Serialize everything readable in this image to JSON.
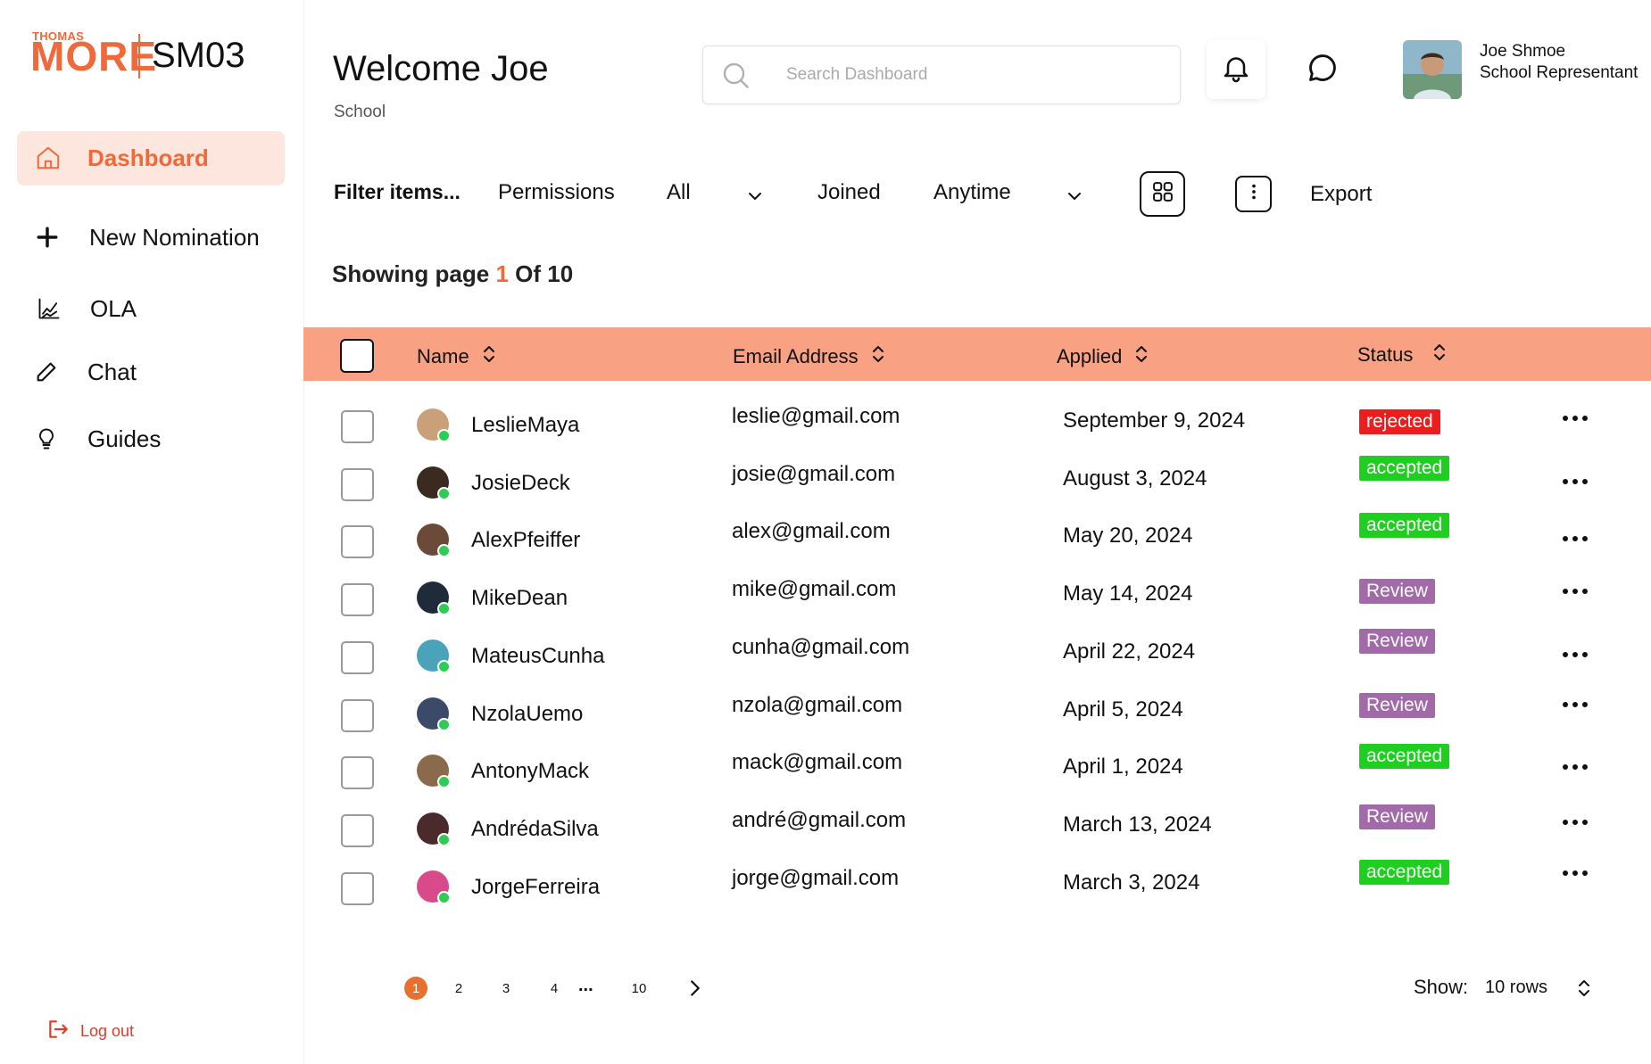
{
  "brand": {
    "top": "THOMAS",
    "main": "MORE",
    "code": "SM03",
    "color": "#ef6a3a"
  },
  "sidebar": {
    "items": [
      {
        "label": "Dashboard",
        "icon": "home-icon",
        "active": true
      },
      {
        "label": "New Nomination",
        "icon": "plus-icon"
      },
      {
        "label": "OLA",
        "icon": "chart-icon"
      },
      {
        "label": "Chat",
        "icon": "pencil-icon"
      },
      {
        "label": "Guides",
        "icon": "lightbulb-icon"
      }
    ],
    "logout": "Log out"
  },
  "header": {
    "title": "Welcome Joe",
    "subtitle": "School",
    "search_placeholder": "Search Dashboard",
    "user": {
      "name": "Joe Shmoe",
      "role": "School Representant"
    }
  },
  "filters": {
    "label": "Filter items...",
    "permissions": "Permissions",
    "all": "All",
    "joined": "Joined",
    "anytime": "Anytime",
    "export": "Export"
  },
  "paging_info": {
    "prefix": "Showing page",
    "current": "1",
    "suffix": "Of 10"
  },
  "table": {
    "header_color": "#f9a283",
    "columns": [
      "Name",
      "Email Address",
      "Applied",
      "Status"
    ],
    "rows": [
      {
        "name": "LeslieMaya",
        "email": "leslie@gmail.com",
        "applied": "September 9, 2024",
        "status": "rejected",
        "avatar": "#c9a07a"
      },
      {
        "name": "JosieDeck",
        "email": "josie@gmail.com",
        "applied": "August 3, 2024",
        "status": "accepted",
        "avatar": "#3b2a20"
      },
      {
        "name": "AlexPfeiffer",
        "email": "alex@gmail.com",
        "applied": "May 20, 2024",
        "status": "accepted",
        "avatar": "#6b4a3a"
      },
      {
        "name": "MikeDean",
        "email": "mike@gmail.com",
        "applied": "May 14, 2024",
        "status": "Review",
        "avatar": "#1f2a3a"
      },
      {
        "name": "MateusCunha",
        "email": "cunha@gmail.com",
        "applied": "April 22, 2024",
        "status": "Review",
        "avatar": "#4aa3b8"
      },
      {
        "name": "NzolaUemo",
        "email": "nzola@gmail.com",
        "applied": "April 5, 2024",
        "status": "Review",
        "avatar": "#3c4a6a"
      },
      {
        "name": "AntonyMack",
        "email": "mack@gmail.com",
        "applied": "April 1, 2024",
        "status": "accepted",
        "avatar": "#8a6a4a"
      },
      {
        "name": "AndrédaSilva",
        "email": "andré@gmail.com",
        "applied": "March 13, 2024",
        "status": "Review",
        "avatar": "#4a2a2a"
      },
      {
        "name": "JorgeFerreira",
        "email": "jorge@gmail.com",
        "applied": "March 3, 2024",
        "status": "accepted",
        "avatar": "#d94a8a"
      }
    ],
    "status_colors": {
      "rejected": "#ee1c1c",
      "accepted": "#1fcf1f",
      "Review": "#a26aa8"
    }
  },
  "pagination": {
    "pages": [
      "1",
      "2",
      "3",
      "4"
    ],
    "ellipsis": "...",
    "last": "10",
    "current": "1"
  },
  "rows_per_page": {
    "label": "Show:",
    "value": "10 rows"
  }
}
